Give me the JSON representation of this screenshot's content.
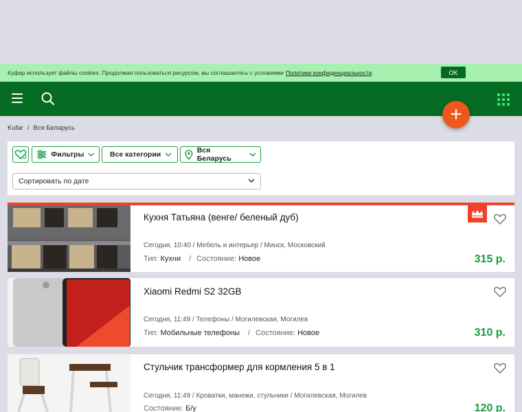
{
  "cookie": {
    "text": "Куфар использует файлы cookies. Продолжая пользоваться ресурсом, вы соглашаетесь с условиями",
    "link": "Политики конфиденциальности",
    "period": ".",
    "ok_label": "OK"
  },
  "header": {
    "menu_icon": "hamburger-icon",
    "search_icon": "search-icon",
    "apps_icon": "grid-icon",
    "fab_label": "+"
  },
  "breadcrumb": {
    "items": [
      "Kufar",
      "Вся Беларусь"
    ],
    "separator": "/"
  },
  "filters": {
    "saved_icon": "heart-icon",
    "filters_label": "Фильтры",
    "categories_label": "Все категории",
    "region_label": "Вся Беларусь",
    "sort_label": "Сортировать по дате"
  },
  "listings": [
    {
      "title": "Кухня Татьяна (венге/ беленый дуб)",
      "meta": "Сегодня, 10:40 / Мебель и интерьер / Минск, Московский",
      "type_label": "Тип:",
      "type_value": "Кухни",
      "cond_label": "Состояние:",
      "cond_value": "Новое",
      "price": "315 р.",
      "vip": true
    },
    {
      "title": "Xiaomi Redmi S2 32GB",
      "meta": "Сегодня, 11:49 / Телефоны / Могилевская, Могилев",
      "type_label": "Тип:",
      "type_value": "Мобильные телефоны",
      "cond_label": "Состояние:",
      "cond_value": "Новое",
      "price": "310 р.",
      "vip": false
    },
    {
      "title": "Стульчик трансформер для кормления 5 в 1",
      "meta": "Сегодня, 11:49 / Кроватки, манежи, стульчики / Могилевская, Могилев",
      "cond_label": "Состояние:",
      "cond_value": "Б/у",
      "price": "120 р.",
      "vip": false
    }
  ],
  "colors": {
    "brand_green": "#066b22",
    "cookie_bg": "#a6f0b0",
    "accent_orange": "#f0571c",
    "vip_red": "#f0412b",
    "price_green": "#189c41"
  }
}
